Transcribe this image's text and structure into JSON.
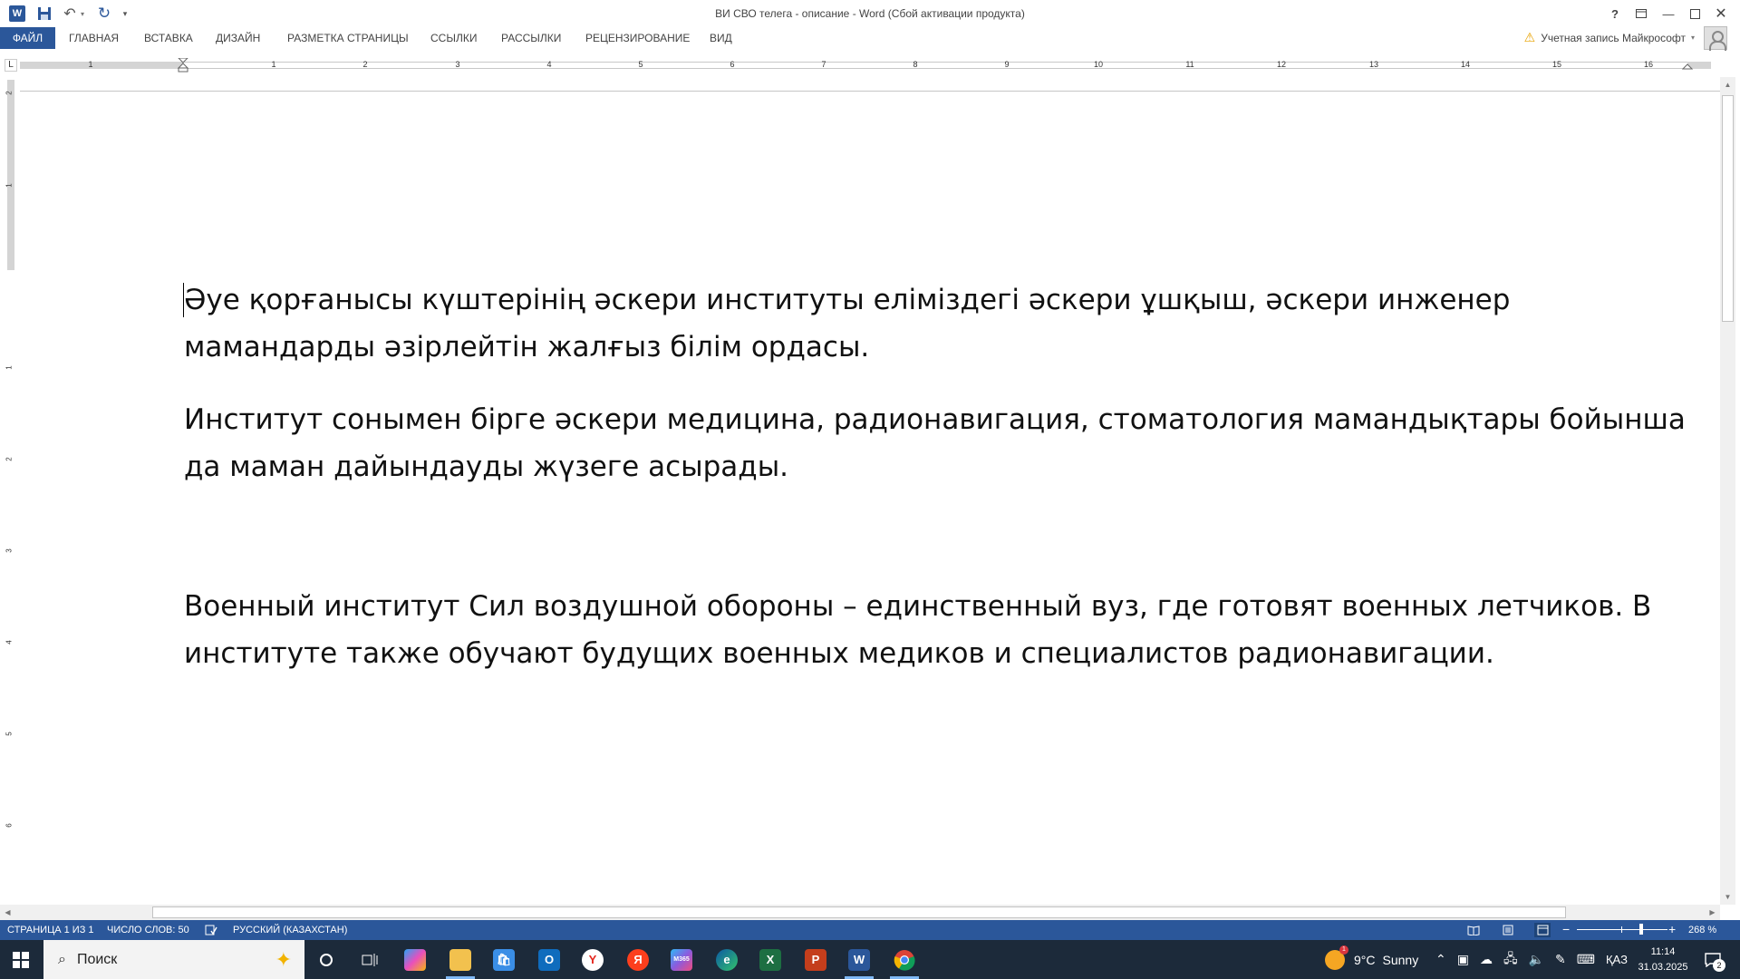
{
  "window": {
    "title": "ВИ СВО телега - описание - Word (Сбой активации продукта)",
    "app_icon": "word-icon",
    "controls": [
      "help-icon",
      "ribbon-display-icon",
      "minimize-icon",
      "maximize-icon",
      "close-icon"
    ]
  },
  "ribbon": {
    "tabs": [
      "ФАЙЛ",
      "ГЛАВНАЯ",
      "ВСТАВКА",
      "ДИЗАЙН",
      "РАЗМЕТКА СТРАНИЦЫ",
      "ССЫЛКИ",
      "РАССЫЛКИ",
      "РЕЦЕНЗИРОВАНИЕ",
      "ВИД"
    ],
    "account_label": "Учетная запись Майкрософт"
  },
  "ruler": {
    "horizontal_numbers": [
      "1",
      "1",
      "2",
      "3",
      "4",
      "5",
      "6",
      "7",
      "8",
      "9",
      "10",
      "11",
      "12",
      "13",
      "14",
      "15",
      "16"
    ],
    "vertical_numbers": [
      "2",
      "1",
      "1",
      "2",
      "3",
      "4",
      "5",
      "6"
    ]
  },
  "document": {
    "paragraphs": [
      "Әуе қорғанысы күштерінің әскери институты еліміздегі әскери ұшқыш, әскери инженер мамандарды әзірлейтін жалғыз білім ордасы.",
      "Институт сонымен бірге әскери медицина, радионавигация, стоматология мамандықтары бойынша да маман дайындауды жүзеге асырады.",
      "Военный институт Сил воздушной обороны – единственный вуз, где готовят военных летчиков. В институте также обучают будущих военных медиков и специалистов радионавигации."
    ]
  },
  "statusbar": {
    "page": "СТРАНИЦА 1 ИЗ 1",
    "words": "ЧИСЛО СЛОВ: 50",
    "language": "РУССКИЙ (КАЗАХСТАН)",
    "zoom": "268 %",
    "zoom_level_percent": 268
  },
  "taskbar": {
    "search_placeholder": "Поиск",
    "apps": [
      "windows-start-icon",
      "cortana-icon",
      "task-view-icon",
      "copilot-icon",
      "file-explorer-icon",
      "store-icon",
      "outlook-icon",
      "yandex-browser-icon",
      "yandex-icon",
      "microsoft365-icon",
      "edge-icon",
      "excel-icon",
      "powerpoint-icon",
      "word-icon",
      "chrome-icon"
    ],
    "weather_temp": "9°C",
    "weather_text": "Sunny",
    "weather_badge": "1",
    "language": "ҚАЗ",
    "time": "11:14",
    "date": "31.03.2025",
    "notification_count": "2"
  },
  "colors": {
    "word_blue": "#2b579a",
    "taskbar": "#1c2a3a"
  }
}
